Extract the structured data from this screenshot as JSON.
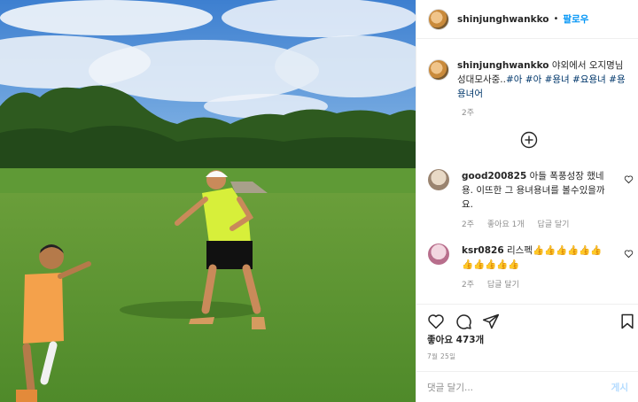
{
  "post": {
    "username": "shinjunghwankko",
    "follow_label": "팔로우",
    "separator": "•"
  },
  "caption": {
    "username": "shinjunghwankko",
    "text": "야외에서 오지명님 성대모사중..",
    "tags": "#아 #아 #용녀 #요용녀 #용용녀어",
    "time": "2주"
  },
  "comments": [
    {
      "username": "good200825",
      "text": "아들 폭풍성장 했네용. 이뜨한 그 용녀용녀를 볼수있을까요.",
      "time": "2주",
      "likes": "좋아요 1개",
      "reply": "답글 달기"
    },
    {
      "username": "ksr0826",
      "text": "리스펙👍👍👍👍👍👍👍👍👍👍👍",
      "time": "2주",
      "reply": "답글 달기"
    }
  ],
  "likes_text": "좋아요 473개",
  "date_text": "7월 25일",
  "add_comment": {
    "placeholder": "댓글 달기...",
    "post_label": "게시"
  },
  "icons": {
    "more": "plus-circle-icon",
    "like": "heart-icon",
    "comment": "comment-icon",
    "share": "send-icon",
    "save": "bookmark-icon"
  },
  "colors": {
    "accent": "#0095f6",
    "tag": "#00376b",
    "muted": "#8e8e8e",
    "post_disabled": "#b3dbff"
  }
}
